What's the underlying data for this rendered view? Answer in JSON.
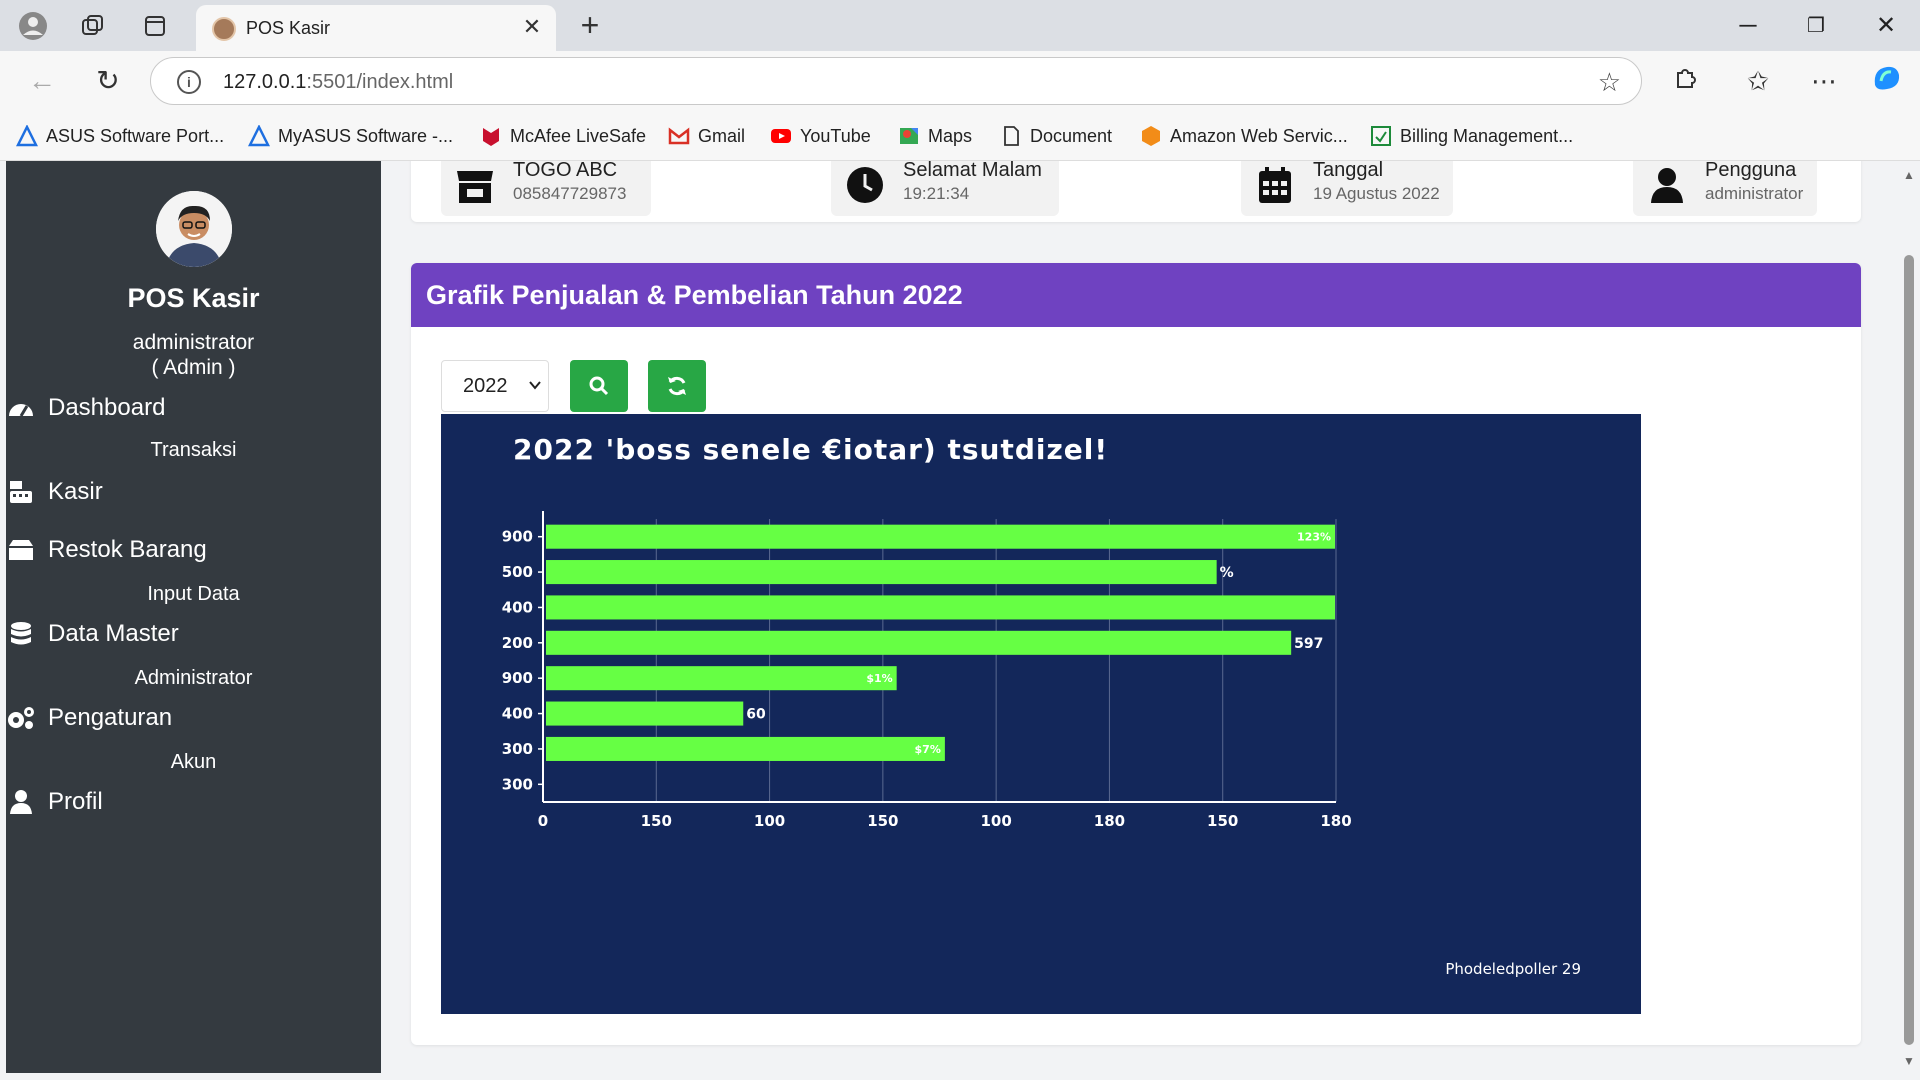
{
  "browser": {
    "tab_title": "POS Kasir",
    "url_host": "127.0.0.1",
    "url_rest": ":5501/index.html",
    "bookmarks": [
      {
        "label": "ASUS Software Port...",
        "icon": "asus-icon"
      },
      {
        "label": "MyASUS Software -...",
        "icon": "asus-icon"
      },
      {
        "label": "McAfee LiveSafe",
        "icon": "mcafee-icon"
      },
      {
        "label": "Gmail",
        "icon": "gmail-icon"
      },
      {
        "label": "YouTube",
        "icon": "youtube-icon"
      },
      {
        "label": "Maps",
        "icon": "maps-icon"
      },
      {
        "label": "Document",
        "icon": "document-icon"
      },
      {
        "label": "Amazon Web Servic...",
        "icon": "aws-icon"
      },
      {
        "label": "Billing Management...",
        "icon": "billing-icon"
      }
    ]
  },
  "sidebar": {
    "brand": "POS Kasir",
    "user_name": "administrator",
    "user_role": "( Admin )",
    "menu": [
      {
        "label": "Dashboard",
        "icon": "dashboard-icon",
        "sub": "Transaksi"
      },
      {
        "label": "Kasir",
        "icon": "keyboard-icon",
        "sub": ""
      },
      {
        "label": "Restok Barang",
        "icon": "box-icon",
        "sub": "Input Data"
      },
      {
        "label": "Data Master",
        "icon": "database-icon",
        "sub": "Administrator"
      },
      {
        "label": "Pengaturan",
        "icon": "gears-icon",
        "sub": "Akun"
      },
      {
        "label": "Profil",
        "icon": "user-icon",
        "sub": ""
      }
    ]
  },
  "info": {
    "store_name": "TOGO ABC",
    "store_phone": "085847729873",
    "greeting": "Selamat Malam",
    "time": "19:21:34",
    "date_label": "Tanggal",
    "date_value": "19 Agustus 2022",
    "user_label": "Pengguna",
    "user_value": "administrator"
  },
  "panel": {
    "title": "Grafik Penjualan & Pembelian Tahun 2022",
    "year_selected": "2022"
  },
  "colors": {
    "accent": "#6f42c1",
    "sidebar_bg": "#343a40",
    "button_green": "#28a745",
    "chart_bg": "#13275a",
    "bar_color": "#66ff44"
  },
  "chart_data": {
    "type": "bar",
    "orientation": "horizontal",
    "title": "2022 'boss senele €iotar) tsutdizel!",
    "categories": [
      "900",
      "500",
      "400",
      "200",
      "900",
      "400",
      "300",
      "300"
    ],
    "values": [
      180,
      153,
      180,
      170,
      80,
      45,
      91,
      null
    ],
    "data_labels": [
      "123%",
      "%",
      "",
      "597",
      "$1%",
      "60",
      "$7%",
      ""
    ],
    "x_tick_labels": [
      "0",
      "150",
      "100",
      "150",
      "100",
      "180",
      "150",
      "180"
    ],
    "xlim": [
      0,
      180
    ],
    "grid": true,
    "footnote": "Phodeledpoller 29"
  }
}
